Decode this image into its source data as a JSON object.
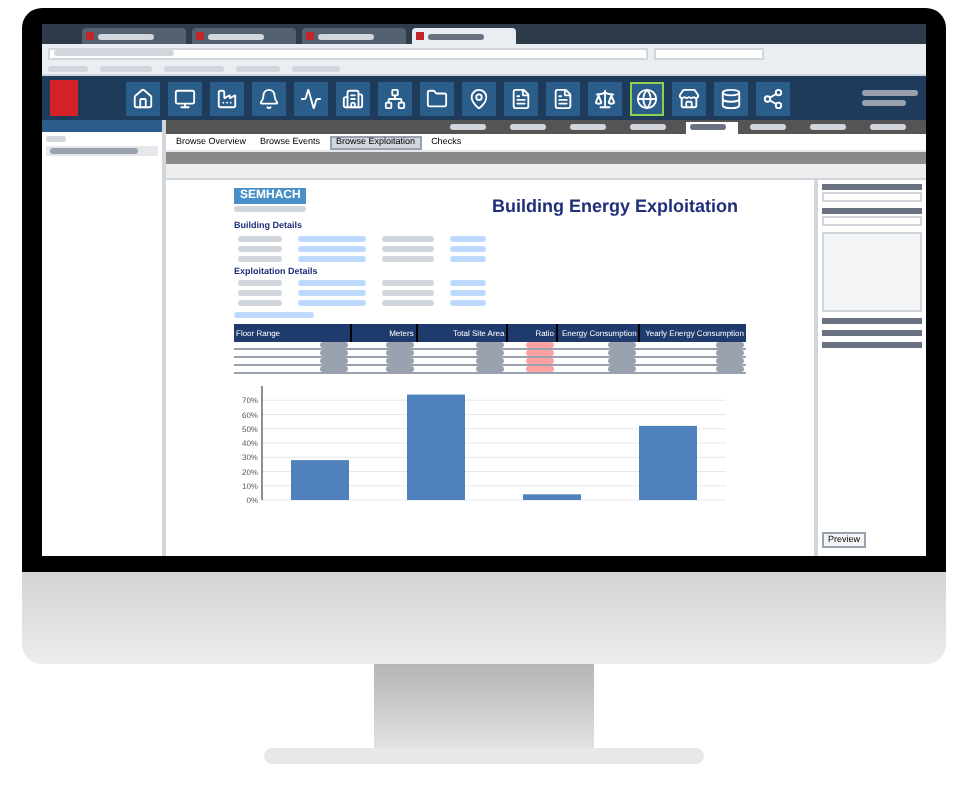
{
  "browser": {
    "tabs": [
      {
        "selected": false
      },
      {
        "selected": false
      },
      {
        "selected": false
      },
      {
        "selected": true
      }
    ]
  },
  "nav": {
    "icons": [
      {
        "kind": "home",
        "selected": false
      },
      {
        "kind": "monitor",
        "selected": false
      },
      {
        "kind": "factory",
        "selected": false
      },
      {
        "kind": "bell",
        "selected": false
      },
      {
        "kind": "pulse",
        "selected": false
      },
      {
        "kind": "building",
        "selected": false
      },
      {
        "kind": "network",
        "selected": false
      },
      {
        "kind": "folder",
        "selected": false
      },
      {
        "kind": "pin",
        "selected": false
      },
      {
        "kind": "doc",
        "selected": false
      },
      {
        "kind": "doc",
        "selected": false
      },
      {
        "kind": "scale",
        "selected": false
      },
      {
        "kind": "globe",
        "selected": true
      },
      {
        "kind": "store",
        "selected": false
      },
      {
        "kind": "database",
        "selected": false
      },
      {
        "kind": "share",
        "selected": false
      }
    ]
  },
  "app_tabs": [
    {
      "selected": false
    },
    {
      "selected": false
    },
    {
      "selected": false
    },
    {
      "selected": false
    },
    {
      "selected": true
    },
    {
      "selected": false
    },
    {
      "selected": false
    },
    {
      "selected": false
    }
  ],
  "report_tabs": [
    {
      "label": "Browse Overview",
      "selected": false
    },
    {
      "label": "Browse Events",
      "selected": false
    },
    {
      "label": "Browse Exploitation",
      "selected": true
    },
    {
      "label": "Checks",
      "selected": false
    }
  ],
  "report": {
    "logo": "SEMHACH",
    "title": "Building Energy Exploitation",
    "sections": [
      "Building Details",
      "Exploitation Details"
    ],
    "table": {
      "columns": [
        "Floor Range",
        "Meters",
        "Total Site Area",
        "Ratio",
        "Energy Consumption",
        "Yearly Energy Consumption"
      ]
    },
    "chart_data": {
      "type": "bar",
      "grid": true,
      "values": [
        28,
        74,
        4,
        52
      ],
      "ylim": [
        0,
        80
      ],
      "yticks": [
        {
          "value": 0,
          "label": "0%"
        },
        {
          "value": 10,
          "label": "10%"
        },
        {
          "value": 20,
          "label": "20%"
        },
        {
          "value": 30,
          "label": "30%"
        },
        {
          "value": 40,
          "label": "40%"
        },
        {
          "value": 50,
          "label": "50%"
        },
        {
          "value": 60,
          "label": "60%"
        },
        {
          "value": 70,
          "label": "70%"
        }
      ]
    }
  },
  "side_panel": {
    "button": "Preview"
  }
}
